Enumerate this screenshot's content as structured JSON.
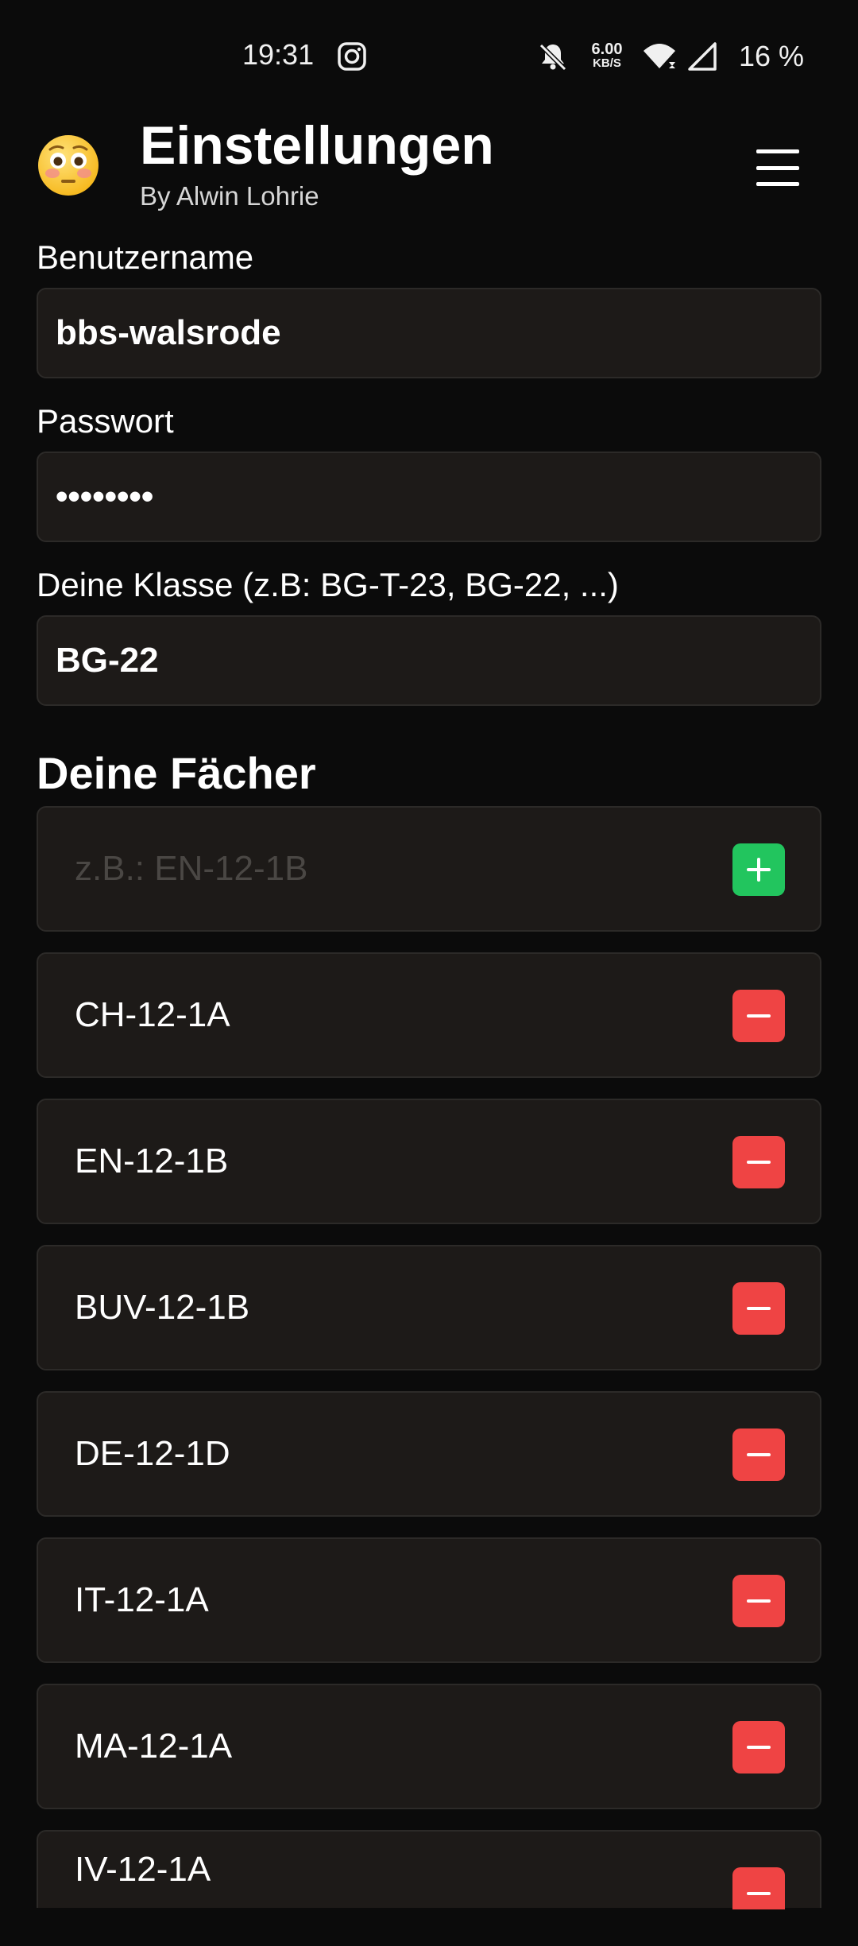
{
  "status_bar": {
    "time": "19:31",
    "speed_value": "6.00",
    "speed_unit": "KB/S",
    "battery": "16 %",
    "icons": [
      "instagram-icon",
      "bell-off-icon",
      "wifi-icon",
      "signal-icon"
    ]
  },
  "header": {
    "emoji_icon": "flushed-face-icon",
    "title": "Einstellungen",
    "subtitle": "By Alwin Lohrie",
    "menu_icon": "hamburger-menu-icon"
  },
  "form": {
    "username": {
      "label": "Benutzername",
      "value": "bbs-walsrode"
    },
    "password": {
      "label": "Passwort",
      "value": "••••••••"
    },
    "class": {
      "label": "Deine Klasse (z.B: BG-T-23, BG-22, ...)",
      "value": "BG-22"
    }
  },
  "subjects": {
    "title": "Deine Fächer",
    "add_placeholder": "z.B.: EN-12-1B",
    "items": [
      "CH-12-1A",
      "EN-12-1B",
      "BUV-12-1B",
      "DE-12-1D",
      "IT-12-1A",
      "MA-12-1A",
      "IV-12-1A"
    ]
  },
  "colors": {
    "background": "#0b0b0b",
    "card": "#1d1a18",
    "add_button": "#22c55e",
    "remove_button": "#ef4444"
  }
}
